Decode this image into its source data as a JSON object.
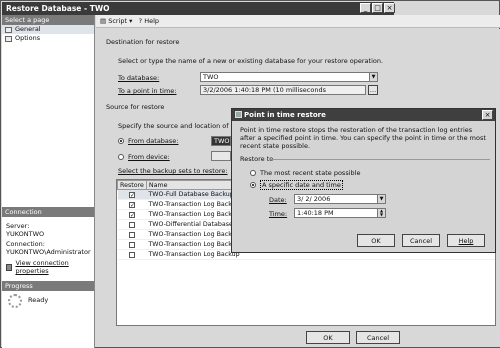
{
  "window": {
    "title": "Restore Database - TWO"
  },
  "left": {
    "select_page_header": "Select a page",
    "pages": [
      {
        "label": "General"
      },
      {
        "label": "Options"
      }
    ],
    "connection_header": "Connection",
    "server_label": "Server:",
    "server_value": "YUKONTWO",
    "connection_label": "Connection:",
    "connection_value": "YUKONTWO\\Administrator",
    "view_props_link": "View connection properties",
    "progress_header": "Progress",
    "progress_status": "Ready"
  },
  "toolbar": {
    "script_label": "Script",
    "help_label": "Help"
  },
  "destination": {
    "section_label": "Destination for restore",
    "instruction": "Select or type the name of a new or existing database for your restore operation.",
    "to_database_label": "To database:",
    "to_database_value": "TWO",
    "to_point_label": "To a point in time:",
    "to_point_value": "3/2/2006 1:40:18 PM (10 milliseconds"
  },
  "source": {
    "section_label": "Source for restore",
    "instruction": "Specify the source and location of backup s",
    "from_database_label": "From database:",
    "from_database_value": "TWO",
    "from_device_label": "From device:",
    "select_sets_label": "Select the backup sets to restore:",
    "columns": [
      "Restore",
      "Name"
    ],
    "rows": [
      {
        "checked": true,
        "name": "TWO-Full Database Backup"
      },
      {
        "checked": true,
        "name": "TWO-Transaction Log  Backup"
      },
      {
        "checked": true,
        "name": "TWO-Transaction Log  Backup"
      },
      {
        "checked": false,
        "name": "TWO-Differential Database Backup"
      },
      {
        "checked": false,
        "name": "TWO-Transaction Log  Backup"
      },
      {
        "checked": false,
        "name": "TWO-Transaction Log  Backup"
      },
      {
        "checked": false,
        "name": "TWO-Transaction Log  Backup"
      }
    ]
  },
  "footer": {
    "ok_label": "OK",
    "cancel_label": "Cancel"
  },
  "dialog": {
    "title": "Point in time restore",
    "description": "Point in time restore stops the restoration of the transaction log entries after a specified point in time. You can specify the point in time or the most recent state possible.",
    "restore_to_label": "Restore to",
    "opt_recent": "The most recent state possible",
    "opt_specific": "A specific date and time",
    "date_label": "Date:",
    "date_value": "3/  2/ 2006",
    "time_label": "Time:",
    "time_value": "1:40:18 PM",
    "ok_label": "OK",
    "cancel_label": "Cancel",
    "help_label": "Help"
  }
}
